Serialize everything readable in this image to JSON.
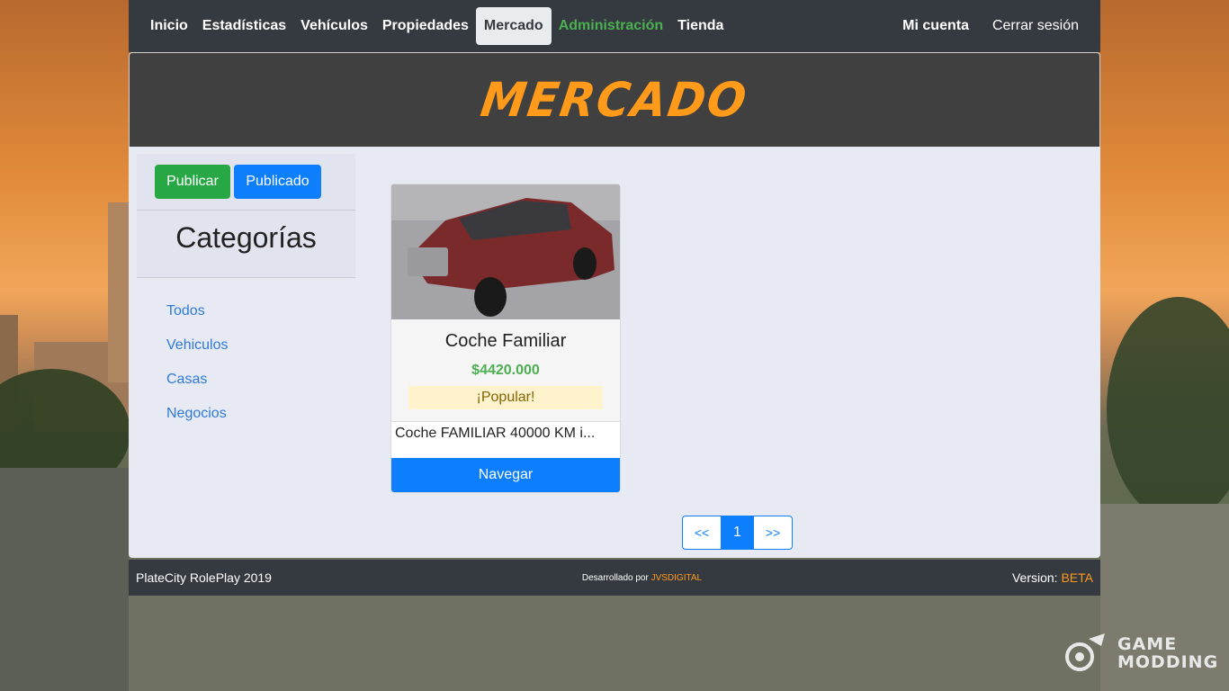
{
  "nav": {
    "items": [
      {
        "label": "Inicio"
      },
      {
        "label": "Estadísticas"
      },
      {
        "label": "Vehículos"
      },
      {
        "label": "Propiedades"
      },
      {
        "label": "Mercado",
        "active": true
      },
      {
        "label": "Administración"
      },
      {
        "label": "Tienda"
      }
    ],
    "account": "Mi cuenta",
    "logout": "Cerrar sesión"
  },
  "header": {
    "title": "MERCADO"
  },
  "sidebar": {
    "publish_button": "Publicar",
    "published_button": "Publicado",
    "categories_title": "Categorías",
    "categories": [
      "Todos",
      "Vehiculos",
      "Casas",
      "Negocios"
    ]
  },
  "listing": {
    "title": "Coche Familiar",
    "price": "$4420.000",
    "badge": "¡Popular!",
    "description": "Coche FAMILIAR 40000 KM i...",
    "button": "Navegar"
  },
  "pagination": {
    "prev": "<<",
    "current": "1",
    "next": ">>"
  },
  "footer": {
    "left": "PlateCity RolePlay 2019",
    "dev_prefix": "Desarrollado por",
    "dev_name": "JVSDIGITAL",
    "version_label": "Version:",
    "version_value": "BETA"
  },
  "watermark": {
    "line1": "GAME",
    "line2": "MODDING"
  },
  "colors": {
    "accent": "#ff9a1a",
    "primary": "#0d7efc",
    "success": "#28a745",
    "nav_bg": "#343a40"
  }
}
